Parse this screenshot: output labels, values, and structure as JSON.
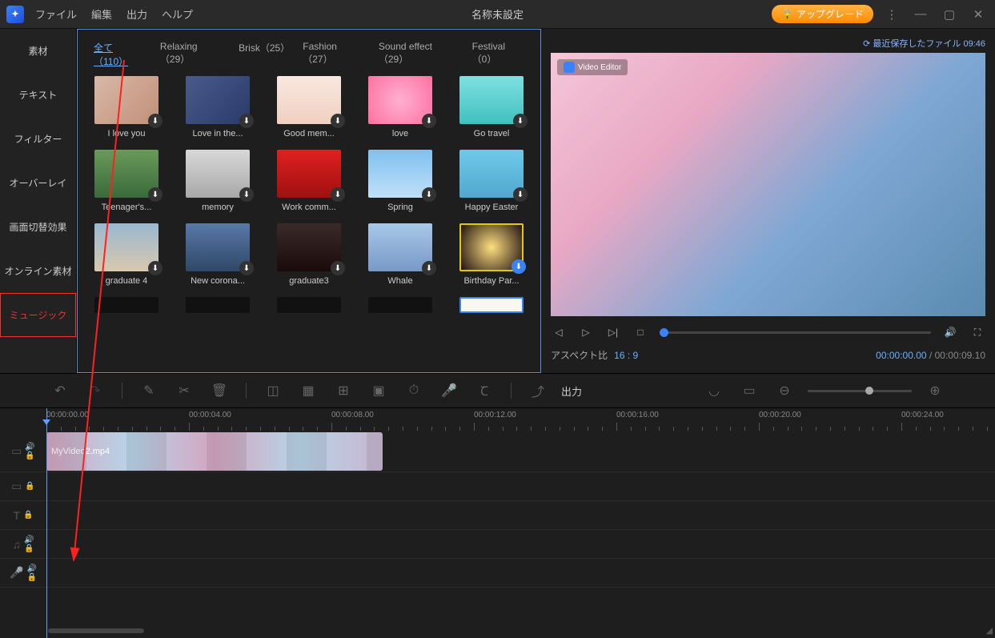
{
  "titlebar": {
    "menus": [
      "ファイル",
      "編集",
      "出力",
      "ヘルプ"
    ],
    "title": "名称未設定",
    "upgrade": "アップグレード"
  },
  "sidebar": {
    "items": [
      {
        "label": "素材"
      },
      {
        "label": "テキスト"
      },
      {
        "label": "フィルター"
      },
      {
        "label": "オーバーレイ"
      },
      {
        "label": "画面切替効果"
      },
      {
        "label": "オンライン素材"
      },
      {
        "label": "ミュージック",
        "active": true
      }
    ]
  },
  "categories": [
    {
      "label": "全て（110）",
      "active": true
    },
    {
      "label": "Relaxing（29）"
    },
    {
      "label": "Brisk（25）"
    },
    {
      "label": "Fashion（27）"
    },
    {
      "label": "Sound effect（29）"
    },
    {
      "label": "Festival（0）"
    }
  ],
  "thumbs": [
    {
      "label": "I love you",
      "bg": "linear-gradient(135deg,#d9b8a8,#c09078)"
    },
    {
      "label": "Love in the...",
      "bg": "linear-gradient(135deg,#4a5a8a,#2a3a6a)"
    },
    {
      "label": "Good mem...",
      "bg": "linear-gradient(#f8e8e0,#f0d0c0)"
    },
    {
      "label": "love",
      "bg": "radial-gradient(circle,#ffb0d0,#ff70a0)"
    },
    {
      "label": "Go travel",
      "bg": "linear-gradient(#80e0e0,#40c0c0)"
    },
    {
      "label": "Teenager's...",
      "bg": "linear-gradient(#6a9a5a,#3a6a3a)"
    },
    {
      "label": "memory",
      "bg": "linear-gradient(#d8d8d8,#a8a8a8)"
    },
    {
      "label": "Work comm...",
      "bg": "linear-gradient(#e02020,#a01010)"
    },
    {
      "label": "Spring",
      "bg": "linear-gradient(#80c0f0,#c0e0f8)"
    },
    {
      "label": "Happy Easter",
      "bg": "linear-gradient(#70c8e8,#50a8d0)"
    },
    {
      "label": "graduate 4",
      "bg": "linear-gradient(#9ab8d0,#d8c8b0)"
    },
    {
      "label": "New corona...",
      "bg": "linear-gradient(#5878a8,#304868)"
    },
    {
      "label": "graduate3",
      "bg": "linear-gradient(#3a2a2a,#1a0a0a)"
    },
    {
      "label": "Whale",
      "bg": "linear-gradient(#a8c8e8,#7898c8)"
    },
    {
      "label": "Birthday Par...",
      "bg": "radial-gradient(circle,#ffe080,#201010)",
      "sel": true,
      "blue": true
    }
  ],
  "preview": {
    "save_info": "⟳ 最近保存したファイル 09:46",
    "badge": "Video Editor",
    "aspect_label": "アスペクト比",
    "aspect_value": "16 : 9",
    "time_current": "00:00:00.00",
    "time_sep": " / ",
    "time_duration": "00:00:09.10"
  },
  "toolbar": {
    "export": "出力"
  },
  "ruler": {
    "marks": [
      "00:00:00.00",
      "00:00:04.00",
      "00:00:08.00",
      "00:00:12.00",
      "00:00:16.00",
      "00:00:20.00",
      "00:00:24.00"
    ]
  },
  "clip": {
    "name": "MyVideo2.mp4"
  }
}
